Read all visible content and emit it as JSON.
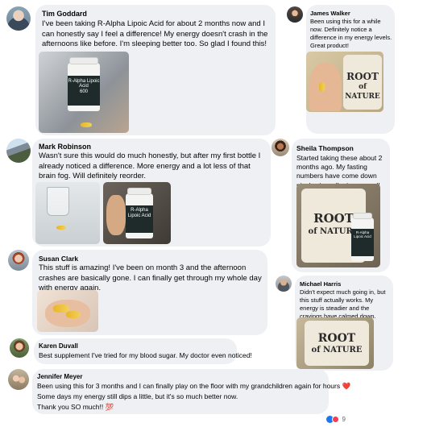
{
  "comments": [
    {
      "name": "Tim Goddard",
      "text": "I've been taking R-Alpha Lipoic Acid for about 2 months now and I can honestly say I feel a difference! My energy doesn't crash in the afternoons like before. I'm sleeping better too. So glad I found this!"
    },
    {
      "name": "Mark Robinson",
      "text": "Wasn't sure this would do much honestly, but after my first bottle I already noticed a difference. More energy and a lot less of that brain fog. Will definitely reorder."
    },
    {
      "name": "Susan Clark",
      "text": "This stuff is amazing! I've been on month 3 and the afternoon crashes are basically gone. I can finally get through my whole day with energy again."
    },
    {
      "name": "Karen Duvall",
      "text": "Best supplement I've tried for my blood sugar. My doctor even noticed!"
    },
    {
      "name": "Jennifer Meyer",
      "line1": "Been using this for 3 months and I can finally play on the floor with my grandchildren again for hours ❤️",
      "line2": "Some days my energy still dips a little, but it's so much better now.",
      "line3": "Thank you SO much!! 💯"
    },
    {
      "name": "James Walker",
      "text": "Been using this for a while now. Definitely notice a difference in my energy levels. Great product!"
    },
    {
      "name": "Sheila Thompson",
      "text": "Started taking these about 2 months ago. My fasting numbers have come down nicely since. I'm impressed!"
    },
    {
      "name": "Michael Harris",
      "text": "Didn't expect much going in, but this stuff actually works. My energy is steadier and the cravings have calmed down."
    }
  ],
  "product": {
    "bottle_label": "R-Alpha Lipoic Acid",
    "bottle_dose": "600",
    "brand_line1": "ROOT",
    "brand_line2": "of NATURE"
  },
  "reactions": {
    "count": "9",
    "icons": [
      "like-icon",
      "love-icon"
    ]
  },
  "colors": {
    "bubble": "#eef0f3",
    "like": "#1877f2",
    "love": "#f33e58"
  }
}
